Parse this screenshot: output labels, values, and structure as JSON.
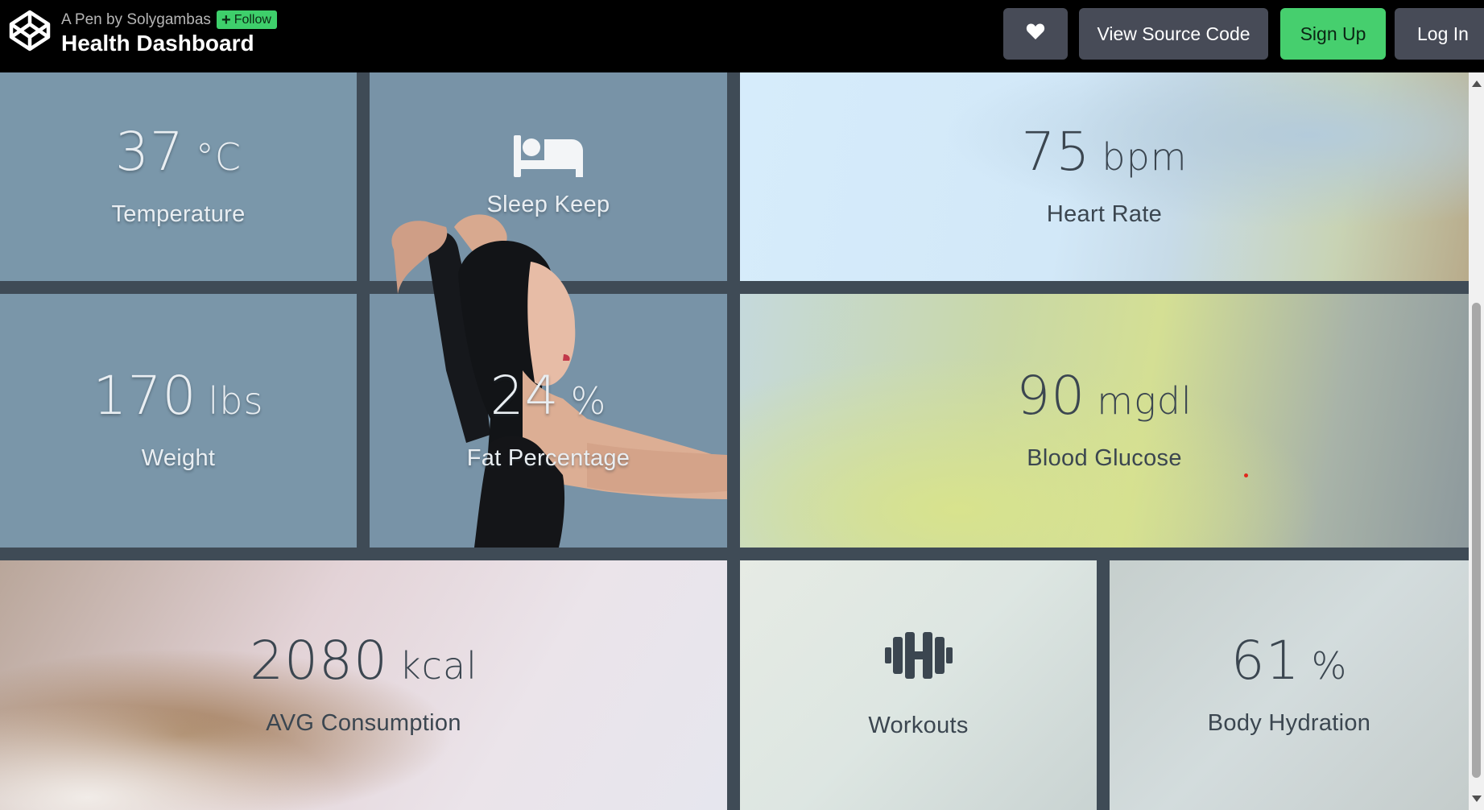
{
  "header": {
    "pen_by": "A Pen by Solygambas",
    "follow_label": "Follow",
    "title": "Health Dashboard",
    "view_source_label": "View Source Code",
    "sign_up_label": "Sign Up",
    "log_in_label": "Log In",
    "heart_icon": "heart-icon",
    "logo_icon": "codepen-logo"
  },
  "colors": {
    "topbar": "#000000",
    "button_gray": "#474b57",
    "sign_up_green": "#46cf6e",
    "follow_green": "#3ecf6b",
    "gap": "#3f4b56"
  },
  "tiles": {
    "temperature": {
      "value": "37",
      "unit": "°C",
      "label": "Temperature"
    },
    "sleep": {
      "icon": "bed-icon",
      "label": "Sleep Keep"
    },
    "heart_rate": {
      "value": "75",
      "unit": "bpm",
      "label": "Heart Rate"
    },
    "weight": {
      "value": "170",
      "unit": "lbs",
      "label": "Weight"
    },
    "fat": {
      "value": "24",
      "unit": "%",
      "label": "Fat Percentage"
    },
    "glucose": {
      "value": "90",
      "unit": "mgdl",
      "label": "Blood Glucose"
    },
    "consumption": {
      "value": "2080",
      "unit": "kcal",
      "label": "AVG Consumption"
    },
    "workouts": {
      "icon": "dumbbell-icon",
      "label": "Workouts"
    },
    "hydration": {
      "value": "61",
      "unit": "%",
      "label": "Body Hydration"
    }
  }
}
